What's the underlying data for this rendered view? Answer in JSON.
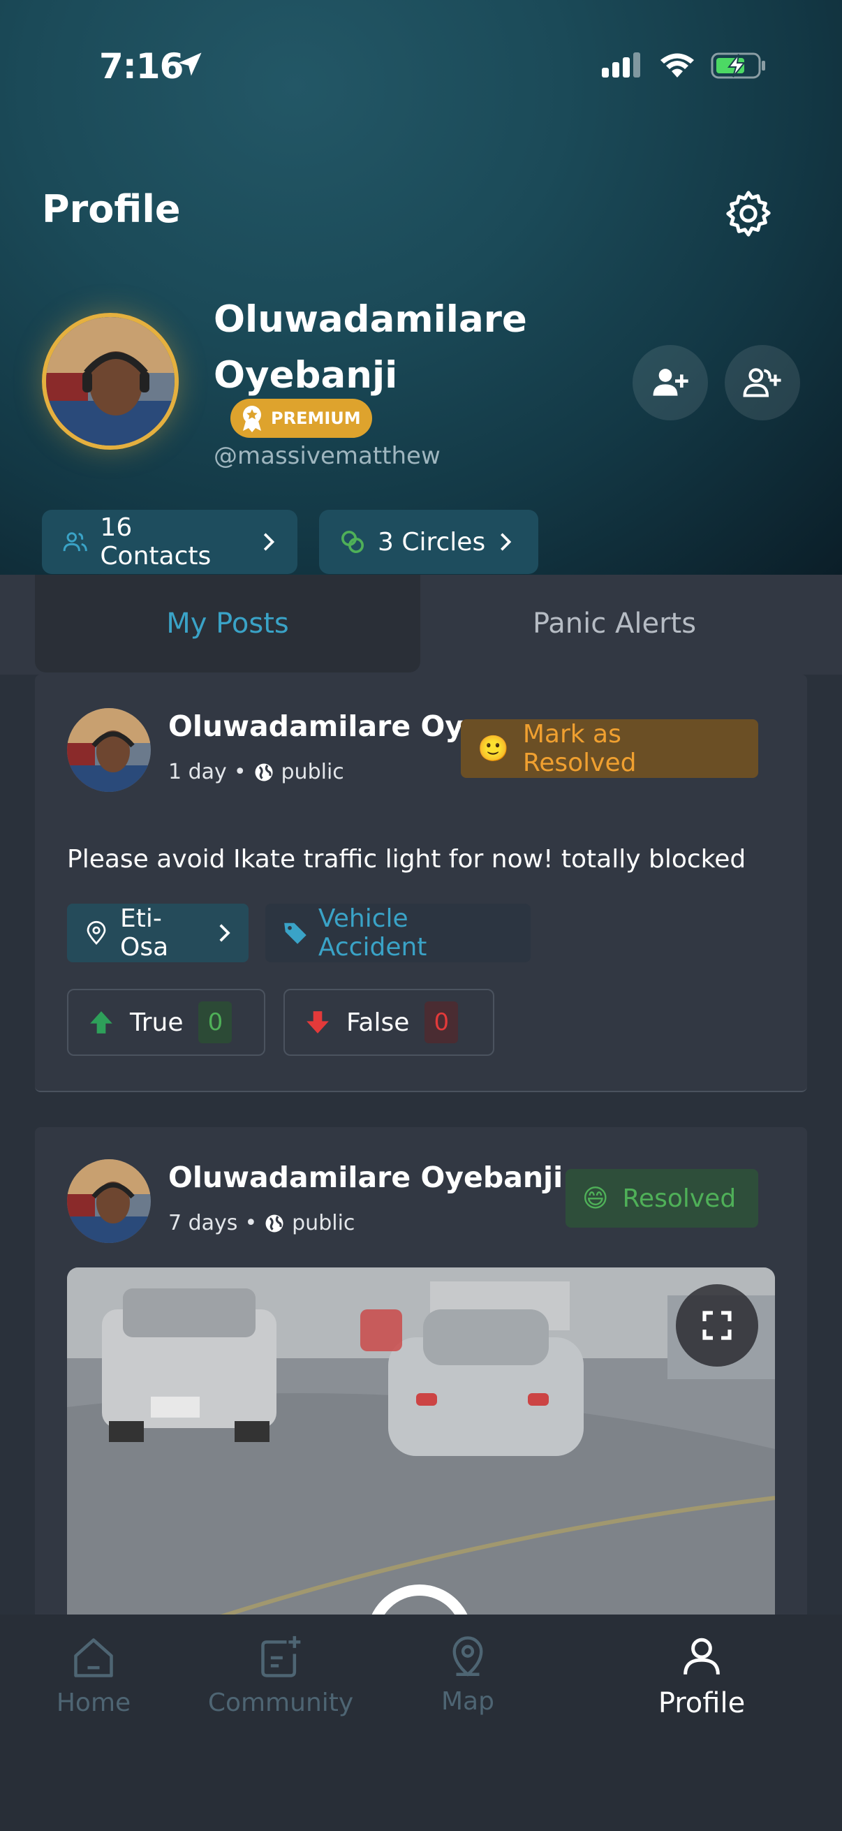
{
  "status_bar": {
    "time": "7:16"
  },
  "header": {
    "title": "Profile",
    "user_name": "Oluwadamilare Oyebanji",
    "badge": "PREMIUM",
    "handle": "@massivematthew",
    "contacts_label": "16 Contacts",
    "circles_label": "3 Circles"
  },
  "tabs": {
    "my_posts": "My Posts",
    "panic_alerts": "Panic Alerts"
  },
  "posts": [
    {
      "author": "Oluwadamilare  Oy...",
      "time": "1 day",
      "visibility": "public",
      "status_label": "Mark as Resolved",
      "status_emoji": "🙂",
      "text": "Please avoid Ikate traffic light for now! totally blocked",
      "location": "Eti-Osa",
      "category": "Vehicle Accident",
      "true_label": "True",
      "true_count": "0",
      "false_label": "False",
      "false_count": "0"
    },
    {
      "author": "Oluwadamilare  Oyebanji",
      "time": "7 days",
      "visibility": "public",
      "status_label": "Resolved",
      "status_emoji": "😄"
    }
  ],
  "bottom_nav": {
    "home": "Home",
    "community": "Community",
    "map": "Map",
    "profile": "Profile"
  },
  "colors": {
    "accent": "#3aa3c7",
    "premium": "#dea32d",
    "resolve_orange": "#f0a030",
    "resolved_green": "#4fb058",
    "vote_true": "#2ea05a",
    "vote_false": "#e33a3a"
  }
}
